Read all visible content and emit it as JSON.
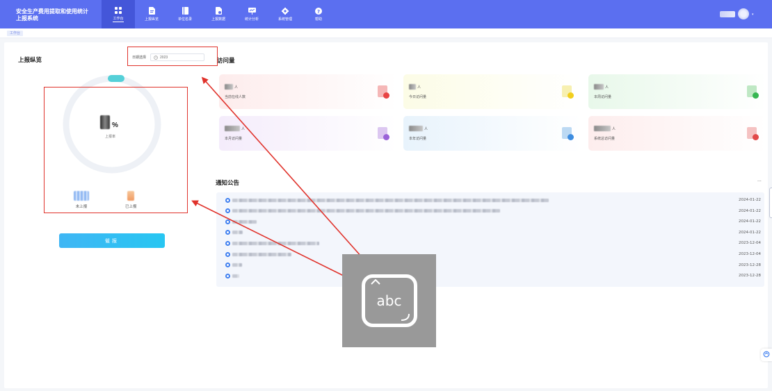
{
  "app": {
    "title": "安全生产费用提取和使用统计上报系统"
  },
  "nav": [
    {
      "label": "工作台",
      "icon": "grid-icon",
      "active": true
    },
    {
      "label": "上报纵览",
      "icon": "report-doc-icon",
      "active": false
    },
    {
      "label": "单位名录",
      "icon": "book-icon",
      "active": false
    },
    {
      "label": "上报数据",
      "icon": "data-doc-icon",
      "active": false
    },
    {
      "label": "统计分析",
      "icon": "chart-board-icon",
      "active": false
    },
    {
      "label": "系统管理",
      "icon": "gear-icon",
      "active": false
    },
    {
      "label": "帮助",
      "icon": "help-icon",
      "active": false
    }
  ],
  "breadcrumb": {
    "tab": "工作台"
  },
  "overview": {
    "title": "上报纵览",
    "date_label": "日期选择",
    "date_value": "2023",
    "percent_unit": "%",
    "ratio_label": "上报率",
    "not_reported_label": "未上报",
    "reported_label": "已上报",
    "report_button": "催报"
  },
  "access": {
    "title": "访问量",
    "unit": "人",
    "cards": [
      {
        "label": "当前在线人数",
        "bg": "#fdecec",
        "icon": "#f5b7b7",
        "dot": "#e84545"
      },
      {
        "label": "今日访问量",
        "bg": "#fcfce6",
        "icon": "#f7f0b0",
        "dot": "#f2cf1d"
      },
      {
        "label": "本周访问量",
        "bg": "#e8f8ea",
        "icon": "#bfe8c4",
        "dot": "#37b652"
      },
      {
        "label": "本月访问量",
        "bg": "#f4ecfb",
        "icon": "#dcc7f1",
        "dot": "#9a63d8"
      },
      {
        "label": "本年访问量",
        "bg": "#e8f3fc",
        "icon": "#bcd9f3",
        "dot": "#3e8de0"
      },
      {
        "label": "系统总访问量",
        "bg": "#fdeded",
        "icon": "#f5c2c2",
        "dot": "#e24a4a"
      }
    ]
  },
  "notices": {
    "title": "通知公告",
    "more": "...",
    "items": [
      {
        "date": "2024-01-22"
      },
      {
        "date": "2024-01-22"
      },
      {
        "date": "2024-01-22"
      },
      {
        "date": "2024-01-22"
      },
      {
        "date": "2023-12-04"
      },
      {
        "date": "2023-12-04"
      },
      {
        "date": "2023-12-28"
      },
      {
        "date": "2023-12-28"
      }
    ]
  },
  "keyboard_overlay": {
    "text": "abc"
  },
  "colors": {
    "header": "#5b6ff0",
    "accent": "#3fb6f4",
    "annotation": "#e0322b"
  }
}
